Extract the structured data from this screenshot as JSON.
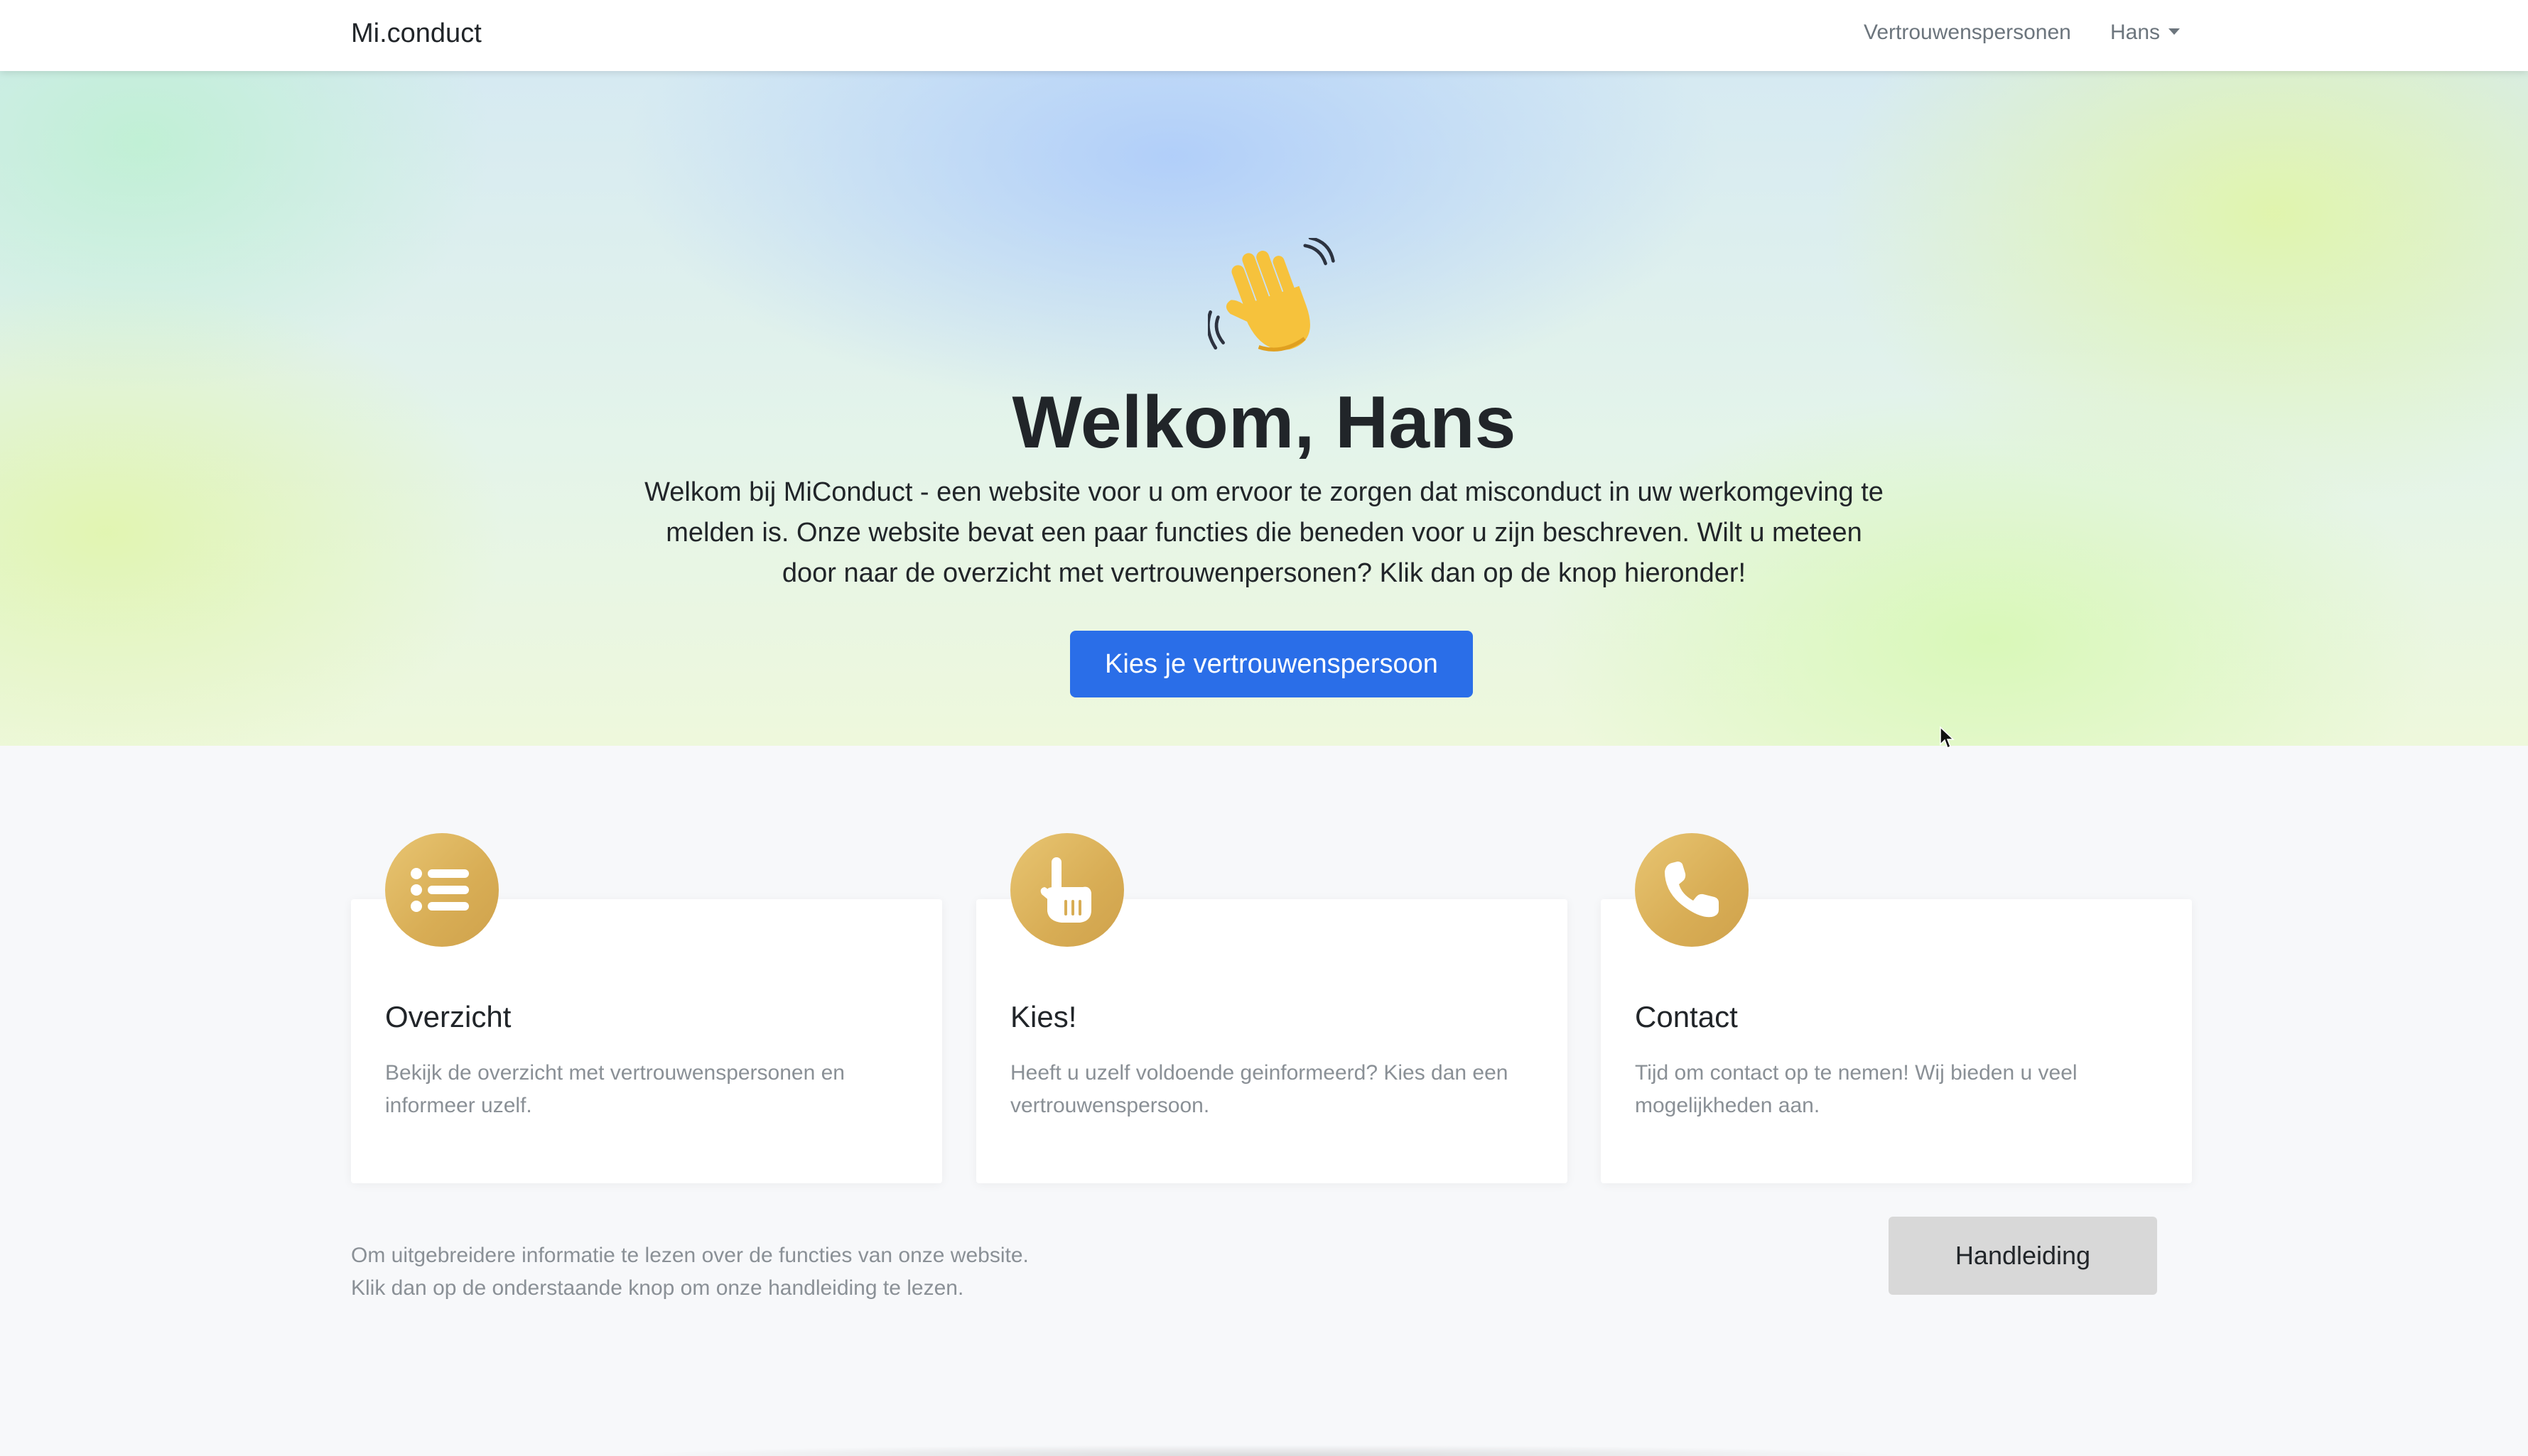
{
  "navbar": {
    "brand": "Mi.conduct",
    "links": [
      "Vertrouwenspersonen"
    ],
    "user_menu": "Hans"
  },
  "hero": {
    "icon": "waving-hand-icon",
    "title": "Welkom, Hans",
    "text": "Welkom bij MiConduct - een website voor u om ervoor te zorgen dat misconduct in uw werkomgeving te melden is. Onze website bevat een paar functies die beneden voor u zijn beschreven. Wilt u meteen door naar de overzicht met vertrouwenpersonen? Klik dan op de knop hieronder!",
    "button": "Kies je vertrouwenspersoon"
  },
  "features": [
    {
      "icon": "list-icon",
      "title": "Overzicht",
      "text": "Bekijk de overzicht met vertrouwenspersonen en informeer uzelf."
    },
    {
      "icon": "pointing-hand-icon",
      "title": "Kies!",
      "text": "Heeft u uzelf voldoende geinformeerd? Kies dan een vertrouwenspersoon."
    },
    {
      "icon": "phone-icon",
      "title": "Contact",
      "text": "Tijd om contact op te nemen! Wij bieden u veel mogelijkheden aan."
    }
  ],
  "info": {
    "line1": "Om uitgebreidere informatie te lezen over de functies van onze website.",
    "line2": "Klik dan op de onderstaande knop om onze handleiding te lezen.",
    "button": "Handleiding"
  },
  "colors": {
    "primary": "#2a6ee8",
    "gold": "#d8ad55",
    "muted_text": "#8a9096",
    "secondary_button": "#d8d8d8"
  }
}
